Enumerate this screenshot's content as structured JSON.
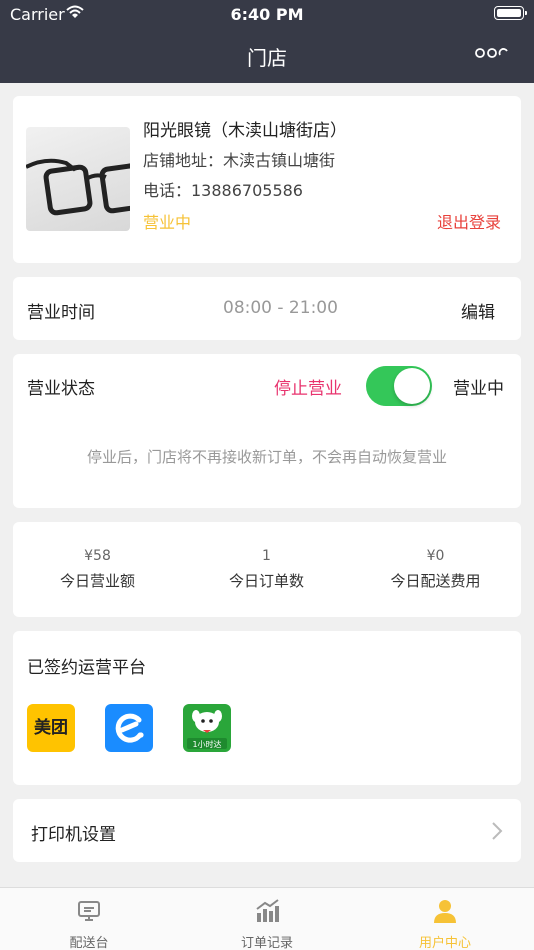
{
  "status_bar": {
    "carrier": "Carrier",
    "time": "6:40 PM"
  },
  "nav": {
    "title": "门店",
    "more_icon": "more-icon"
  },
  "store": {
    "name": "阳光眼镜（木渎山塘街店）",
    "address": "店铺地址：木渎古镇山塘街",
    "phone": "电话：13886705586",
    "open_status": "营业中",
    "logout_label": "退出登录"
  },
  "hours": {
    "label": "营业时间",
    "value": "08:00 - 21:00",
    "edit_label": "编辑"
  },
  "business_status": {
    "label": "营业状态",
    "stop_label": "停止营业",
    "toggle_on": true,
    "state_label": "营业中",
    "note": "停业后，门店将不再接收新订单，不会再自动恢复营业"
  },
  "stats": [
    {
      "value": "¥58",
      "label": "今日营业额"
    },
    {
      "value": "1",
      "label": "今日订单数"
    },
    {
      "value": "¥0",
      "label": "今日配送费用"
    }
  ],
  "platforms": {
    "title": "已签约运营平台",
    "meituan_label": "美团",
    "jd_label": "1小时达"
  },
  "printer": {
    "label": "打印机设置"
  },
  "tabs": [
    {
      "label": "配送台",
      "icon": "monitor-icon"
    },
    {
      "label": "订单记录",
      "icon": "chart-icon"
    },
    {
      "label": "用户中心",
      "icon": "user-icon"
    }
  ],
  "colors": {
    "nav_bg": "#373a47",
    "accent": "#f6c236",
    "danger": "#e8423c",
    "toggle": "#34c759"
  }
}
